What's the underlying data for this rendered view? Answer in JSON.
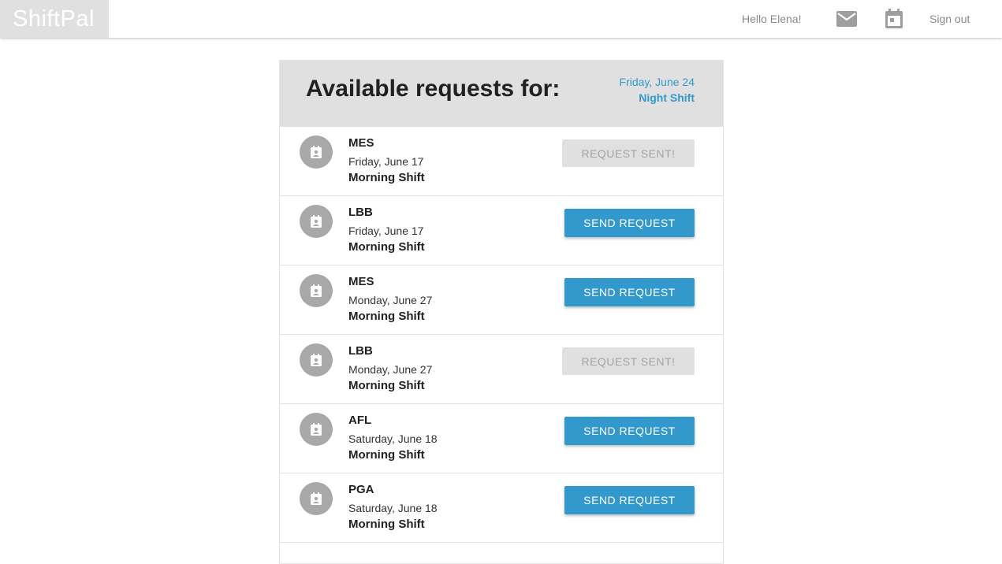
{
  "app": {
    "logo": "ShiftPal"
  },
  "nav": {
    "greeting": "Hello Elena!",
    "mail_icon": "mail-icon",
    "calendar_icon": "calendar-icon",
    "signout_label": "Sign out"
  },
  "panel": {
    "title": "Available requests for:",
    "date": "Friday, June 24",
    "shift": "Night Shift"
  },
  "colors": {
    "accent": "#3399cc",
    "header_bg": "#e0e0e0",
    "avatar": "#a8a8a8"
  },
  "requests": [
    {
      "code": "MES",
      "date": "Friday, June 17",
      "shift": "Morning Shift",
      "status": "sent",
      "button_label": "REQUEST SENT!"
    },
    {
      "code": "LBB",
      "date": "Friday, June 17",
      "shift": "Morning Shift",
      "status": "available",
      "button_label": "SEND REQUEST"
    },
    {
      "code": "MES",
      "date": "Monday, June 27",
      "shift": "Morning Shift",
      "status": "available",
      "button_label": "SEND REQUEST"
    },
    {
      "code": "LBB",
      "date": "Monday, June 27",
      "shift": "Morning Shift",
      "status": "sent",
      "button_label": "REQUEST SENT!"
    },
    {
      "code": "AFL",
      "date": "Saturday, June 18",
      "shift": "Morning Shift",
      "status": "available",
      "button_label": "SEND REQUEST"
    },
    {
      "code": "PGA",
      "date": "Saturday, June 18",
      "shift": "Morning Shift",
      "status": "available",
      "button_label": "SEND REQUEST"
    }
  ]
}
